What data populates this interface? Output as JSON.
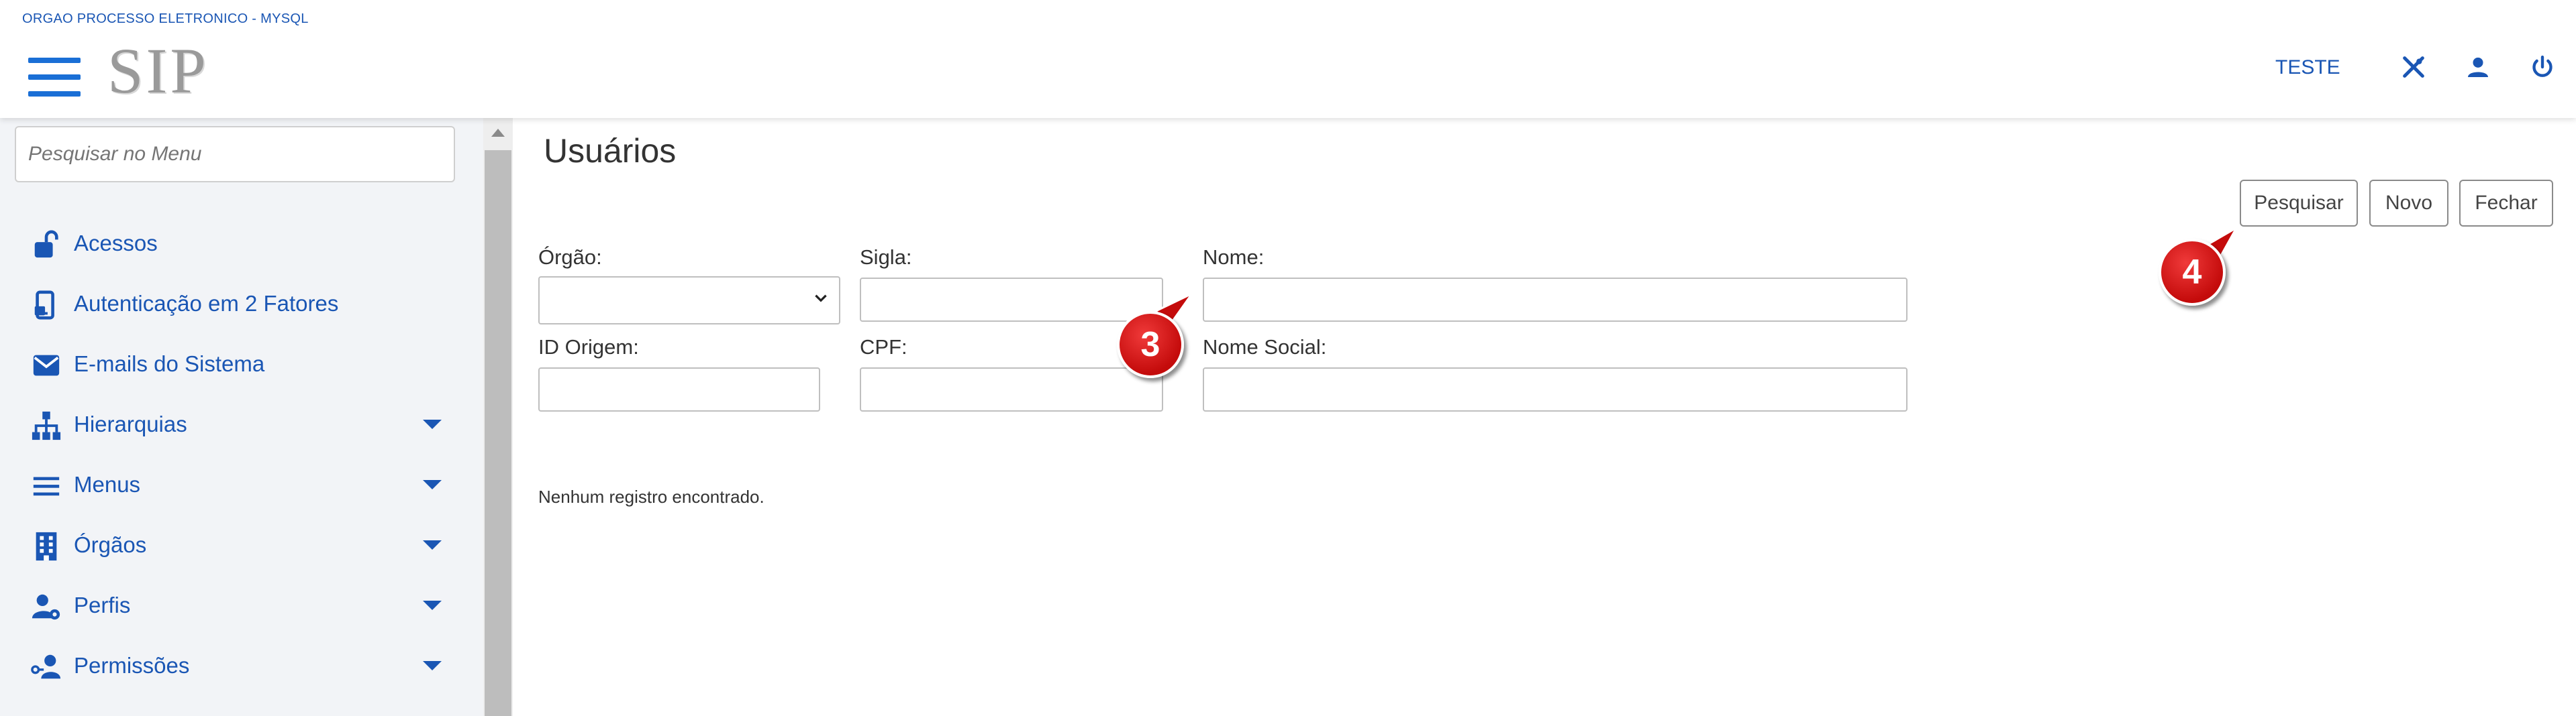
{
  "header": {
    "org_name": "ORGAO PROCESSO ELETRONICO - MYSQL",
    "logo_text": "SIP",
    "user_label": "TESTE",
    "icons": [
      "tools-icon",
      "user-icon",
      "power-icon"
    ],
    "accent_color": "#1a56b4"
  },
  "sidebar": {
    "search_placeholder": "Pesquisar no Menu",
    "items": [
      {
        "label": "Acessos",
        "icon": "unlock-icon",
        "has_submenu": false
      },
      {
        "label": "Autenticação em 2 Fatores",
        "icon": "mobile-lock-icon",
        "has_submenu": false
      },
      {
        "label": "E-mails do Sistema",
        "icon": "envelope-icon",
        "has_submenu": false
      },
      {
        "label": "Hierarquias",
        "icon": "sitemap-icon",
        "has_submenu": true
      },
      {
        "label": "Menus",
        "icon": "bars-icon",
        "has_submenu": true
      },
      {
        "label": "Órgãos",
        "icon": "building-icon",
        "has_submenu": true
      },
      {
        "label": "Perfis",
        "icon": "user-gear-icon",
        "has_submenu": true
      },
      {
        "label": "Permissões",
        "icon": "user-key-icon",
        "has_submenu": true
      }
    ]
  },
  "main": {
    "title": "Usuários",
    "buttons": {
      "search": "Pesquisar",
      "new": "Novo",
      "close": "Fechar"
    },
    "fields": {
      "orgao": {
        "label": "Órgão:",
        "value": ""
      },
      "sigla": {
        "label": "Sigla:",
        "value": ""
      },
      "nome": {
        "label": "Nome:",
        "value": ""
      },
      "id_origem": {
        "label": "ID Origem:",
        "value": ""
      },
      "cpf": {
        "label": "CPF:",
        "value": ""
      },
      "nome_social": {
        "label": "Nome Social:",
        "value": ""
      }
    },
    "empty_message": "Nenhum registro encontrado."
  },
  "annotations": {
    "callout_3": "3",
    "callout_4": "4",
    "callout_color": "#d01010"
  }
}
